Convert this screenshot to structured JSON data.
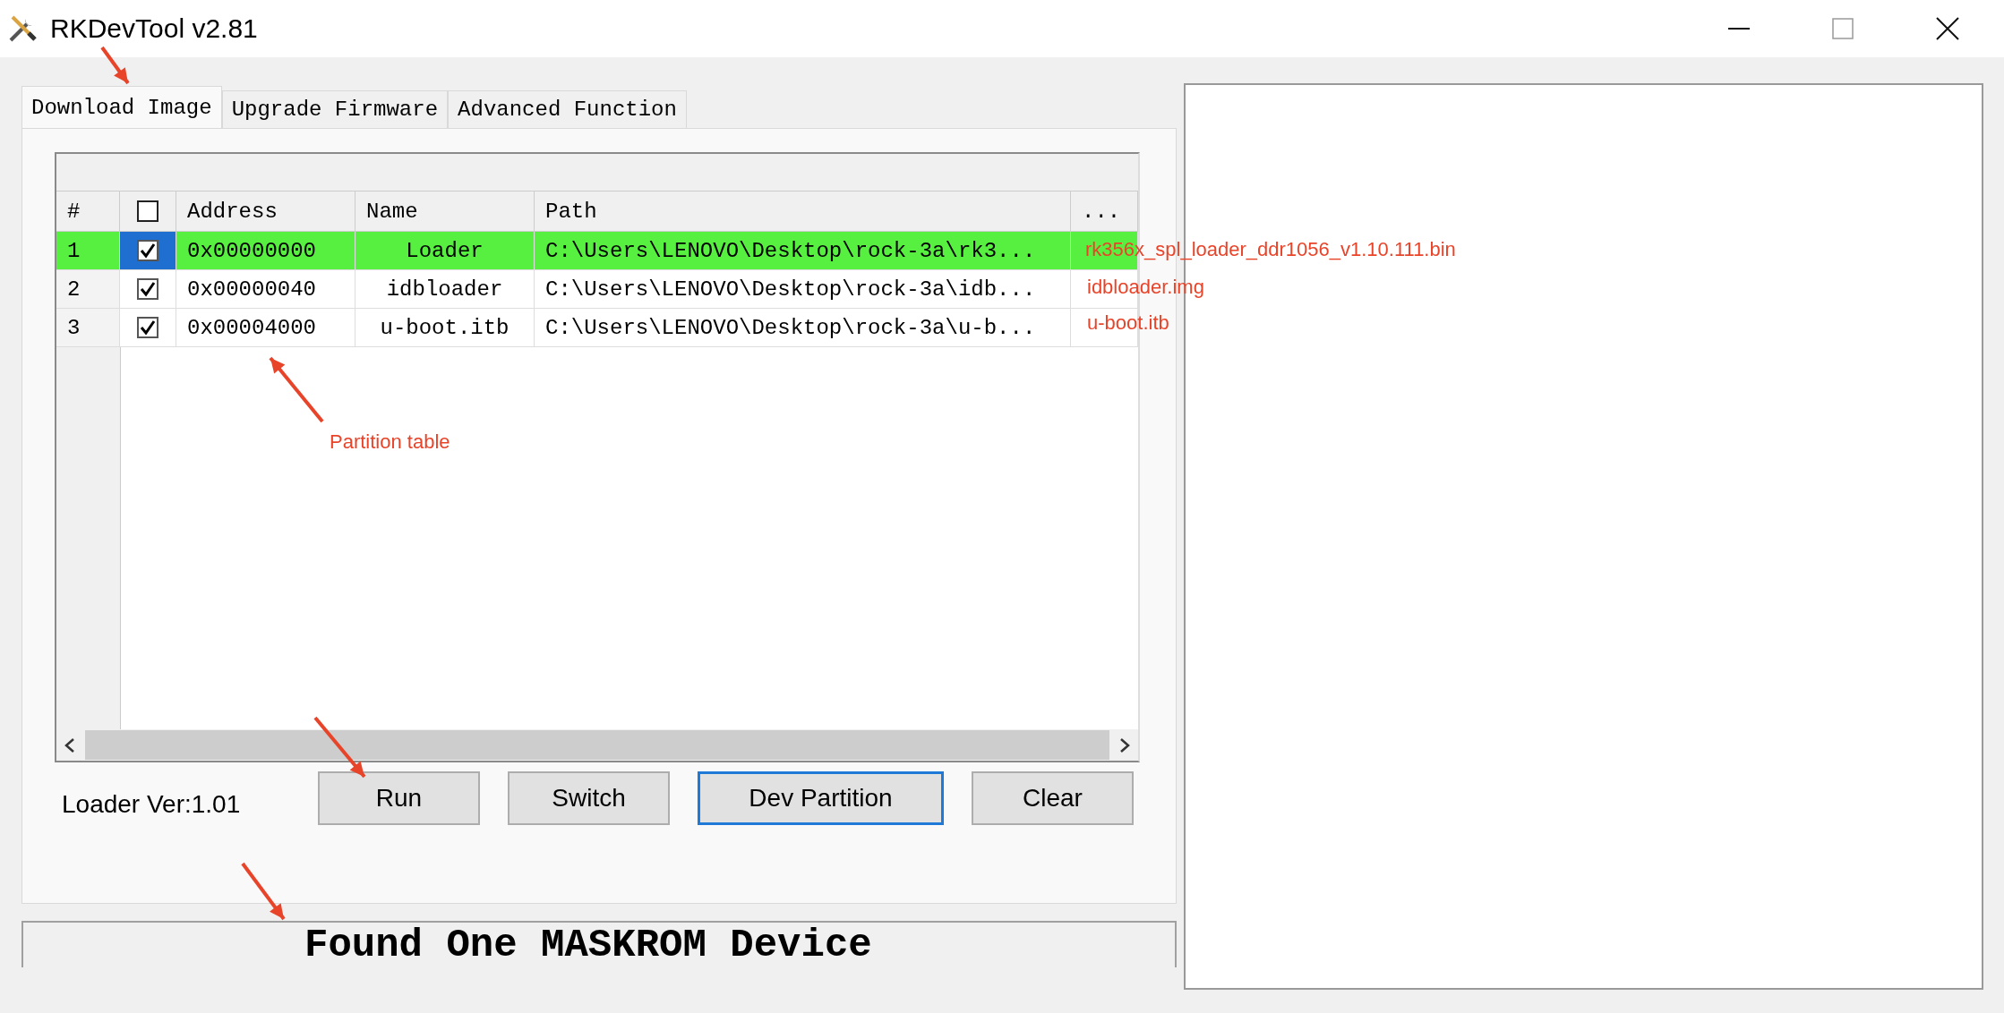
{
  "window": {
    "title": "RKDevTool v2.81"
  },
  "tabs": [
    {
      "label": "Download Image",
      "selected": true
    },
    {
      "label": "Upgrade Firmware",
      "selected": false
    },
    {
      "label": "Advanced Function",
      "selected": false
    }
  ],
  "table": {
    "columns": [
      {
        "kind": "text",
        "label": "#"
      },
      {
        "kind": "checkbox",
        "checked": false
      },
      {
        "kind": "text",
        "label": "Address"
      },
      {
        "kind": "text",
        "label": "Name"
      },
      {
        "kind": "text",
        "label": "Path"
      },
      {
        "kind": "text",
        "label": "..."
      }
    ],
    "rows": [
      {
        "number": "1",
        "checked": true,
        "address": "0x00000000",
        "name": "Loader",
        "path": "C:\\Users\\LENOVO\\Desktop\\rock-3a\\rk3...",
        "selected": true
      },
      {
        "number": "2",
        "checked": true,
        "address": "0x00000040",
        "name": "idbloader",
        "path": "C:\\Users\\LENOVO\\Desktop\\rock-3a\\idb...",
        "selected": false
      },
      {
        "number": "3",
        "checked": true,
        "address": "0x00004000",
        "name": "u-boot.itb",
        "path": "C:\\Users\\LENOVO\\Desktop\\rock-3a\\u-b...",
        "selected": false
      }
    ]
  },
  "loader_version": "Loader Ver:1.01",
  "buttons": [
    {
      "label": "Run",
      "focused": false
    },
    {
      "label": "Switch",
      "focused": false
    },
    {
      "label": "Dev Partition",
      "focused": true
    },
    {
      "label": "Clear",
      "focused": false
    }
  ],
  "status": "Found One MASKROM Device",
  "annotations": [
    {
      "text": "rk356x_spl_loader_ddr1056_v1.10.111.bin"
    },
    {
      "text": "idbloader.img"
    },
    {
      "text": "u-boot.itb"
    },
    {
      "text": "Partition table"
    }
  ]
}
